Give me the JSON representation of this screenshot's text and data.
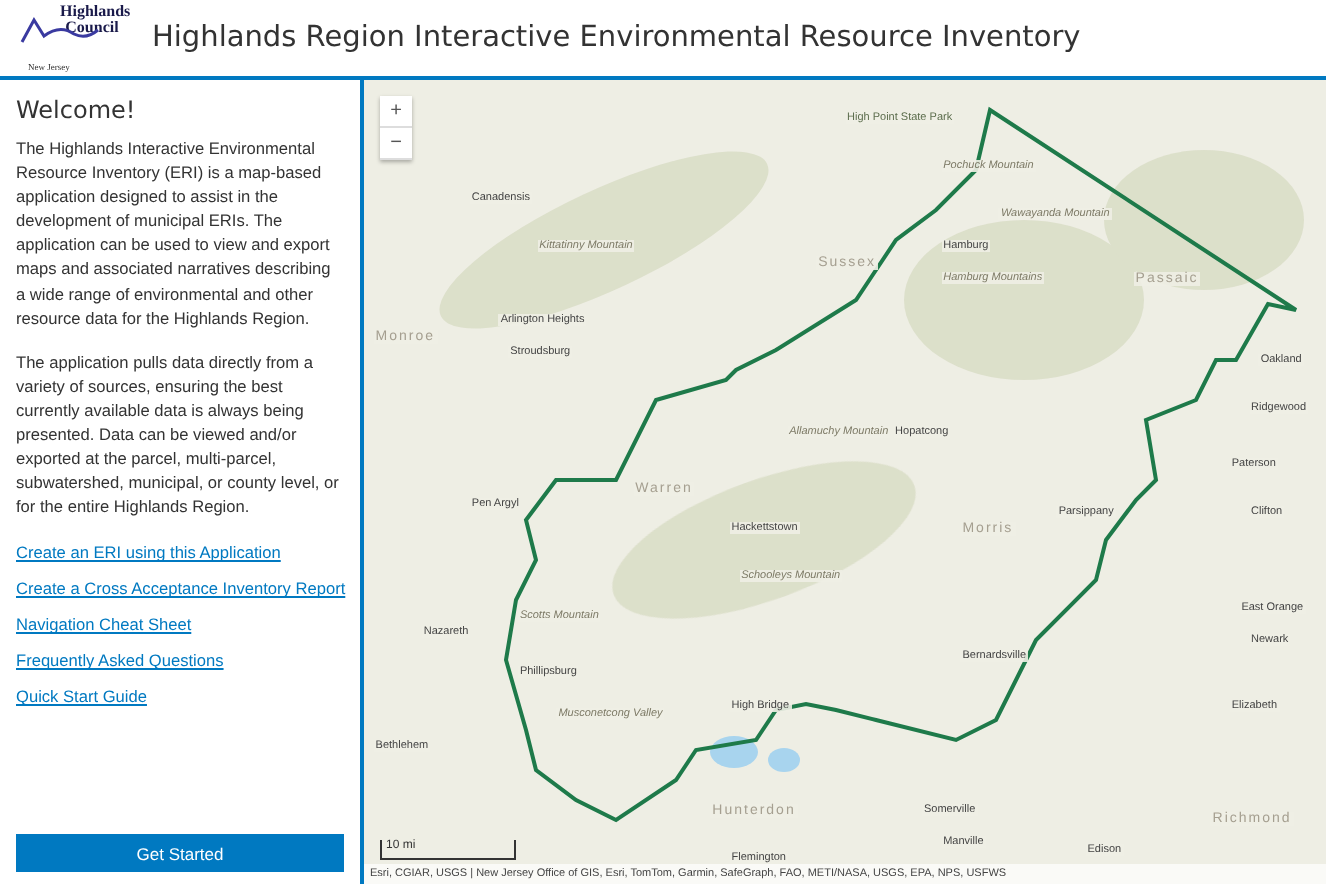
{
  "header": {
    "logo_text": "Highlands Council",
    "logo_subtext": "New Jersey",
    "title": "Highlands Region Interactive Environmental Resource Inventory"
  },
  "sidebar": {
    "heading": "Welcome!",
    "paragraphs": [
      "The Highlands Interactive Environmental Resource Inventory (ERI) is a map-based application designed to assist in the development of municipal ERIs. The application can be used to view and export maps and associated narratives describing a wide range of environmental and other resource data for the Highlands Region.",
      "The application pulls data directly from a variety of sources, ensuring the best currently available data is always being presented. Data can be viewed and/or exported at the parcel, multi-parcel, subwatershed, municipal, or county level, or for the entire Highlands Region."
    ],
    "links": [
      "Create an ERI using this Application",
      "Create a Cross Acceptance Inventory Report",
      "Navigation Cheat Sheet",
      "Frequently Asked Questions",
      "Quick Start Guide"
    ],
    "button": "Get Started"
  },
  "map": {
    "zoom_in": "+",
    "zoom_out": "−",
    "scale": "10 mi",
    "attribution": "Esri, CGIAR, USGS | New Jersey Office of GIS, Esri, TomTom, Garmin, SafeGraph, FAO, METI/NASA, USGS, EPA, NPS, USFWS",
    "labels": [
      {
        "text": "High Point State Park",
        "kind": "park"
      },
      {
        "text": "Pochuck Mountain",
        "kind": "terrain"
      },
      {
        "text": "Canadensis",
        "kind": "town"
      },
      {
        "text": "Wawayanda Mountain",
        "kind": "terrain"
      },
      {
        "text": "Hamburg",
        "kind": "town"
      },
      {
        "text": "Kittatinny Mountain",
        "kind": "terrain"
      },
      {
        "text": "Sussex",
        "kind": "region"
      },
      {
        "text": "Hamburg Mountains",
        "kind": "terrain"
      },
      {
        "text": "Passaic",
        "kind": "region"
      },
      {
        "text": "Monroe",
        "kind": "region"
      },
      {
        "text": "Arlington Heights",
        "kind": "town"
      },
      {
        "text": "Stroudsburg",
        "kind": "town"
      },
      {
        "text": "Oakland",
        "kind": "town"
      },
      {
        "text": "Ridgewood",
        "kind": "town"
      },
      {
        "text": "Allamuchy Mountain",
        "kind": "terrain"
      },
      {
        "text": "Hopatcong",
        "kind": "town"
      },
      {
        "text": "Warren",
        "kind": "region"
      },
      {
        "text": "Paterson",
        "kind": "town"
      },
      {
        "text": "Pen Argyl",
        "kind": "town"
      },
      {
        "text": "Hackettstown",
        "kind": "town"
      },
      {
        "text": "Morris",
        "kind": "region"
      },
      {
        "text": "Parsippany",
        "kind": "town"
      },
      {
        "text": "Clifton",
        "kind": "town"
      },
      {
        "text": "Schooleys Mountain",
        "kind": "terrain"
      },
      {
        "text": "Scotts Mountain",
        "kind": "terrain"
      },
      {
        "text": "Nazareth",
        "kind": "town"
      },
      {
        "text": "East Orange",
        "kind": "town"
      },
      {
        "text": "Phillipsburg",
        "kind": "town"
      },
      {
        "text": "Bernardsville",
        "kind": "town"
      },
      {
        "text": "Newark",
        "kind": "town"
      },
      {
        "text": "Musconetcong Valley",
        "kind": "terrain"
      },
      {
        "text": "High Bridge",
        "kind": "town"
      },
      {
        "text": "Elizabeth",
        "kind": "town"
      },
      {
        "text": "Bethlehem",
        "kind": "town"
      },
      {
        "text": "Hunterdon",
        "kind": "region"
      },
      {
        "text": "Somerville",
        "kind": "town"
      },
      {
        "text": "Manville",
        "kind": "town"
      },
      {
        "text": "Flemington",
        "kind": "town"
      },
      {
        "text": "Edison",
        "kind": "town"
      },
      {
        "text": "Richmond",
        "kind": "region"
      }
    ]
  }
}
